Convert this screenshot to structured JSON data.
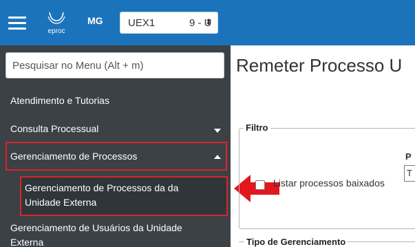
{
  "header": {
    "logo_text": "eproc",
    "state": "MG",
    "unit_code": "UEX1",
    "unit_number": "9 - U",
    "unit_arrow": "⬍"
  },
  "sidebar": {
    "search_placeholder": "Pesquisar no Menu (Alt + m)",
    "items": [
      {
        "label": "Atendimento e Tutorias"
      },
      {
        "label": "Consulta Processual"
      },
      {
        "label": "Gerenciamento de Processos"
      },
      {
        "label": "Gerenciamento de Processos da da Unidade Externa"
      },
      {
        "label": "Gerenciamento de Usuários da Unidade Externa"
      }
    ],
    "sub_lines": [
      "Gerenciamento de Processos da da",
      "Unidade Externa"
    ],
    "last_lines": [
      "Gerenciamento de Usuários da Unidade",
      "Externa"
    ]
  },
  "main": {
    "title": "Remeter Processo U",
    "filter_legend": "Filtro",
    "checkbox_label": "Listar processos baixados",
    "p_label": "P",
    "p_select_value": "T",
    "tipo_legend": "Tipo de Gerenciamento"
  },
  "colors": {
    "topbar": "#1b74bb",
    "sidebar": "#3c4146",
    "highlight": "#d9252b"
  }
}
